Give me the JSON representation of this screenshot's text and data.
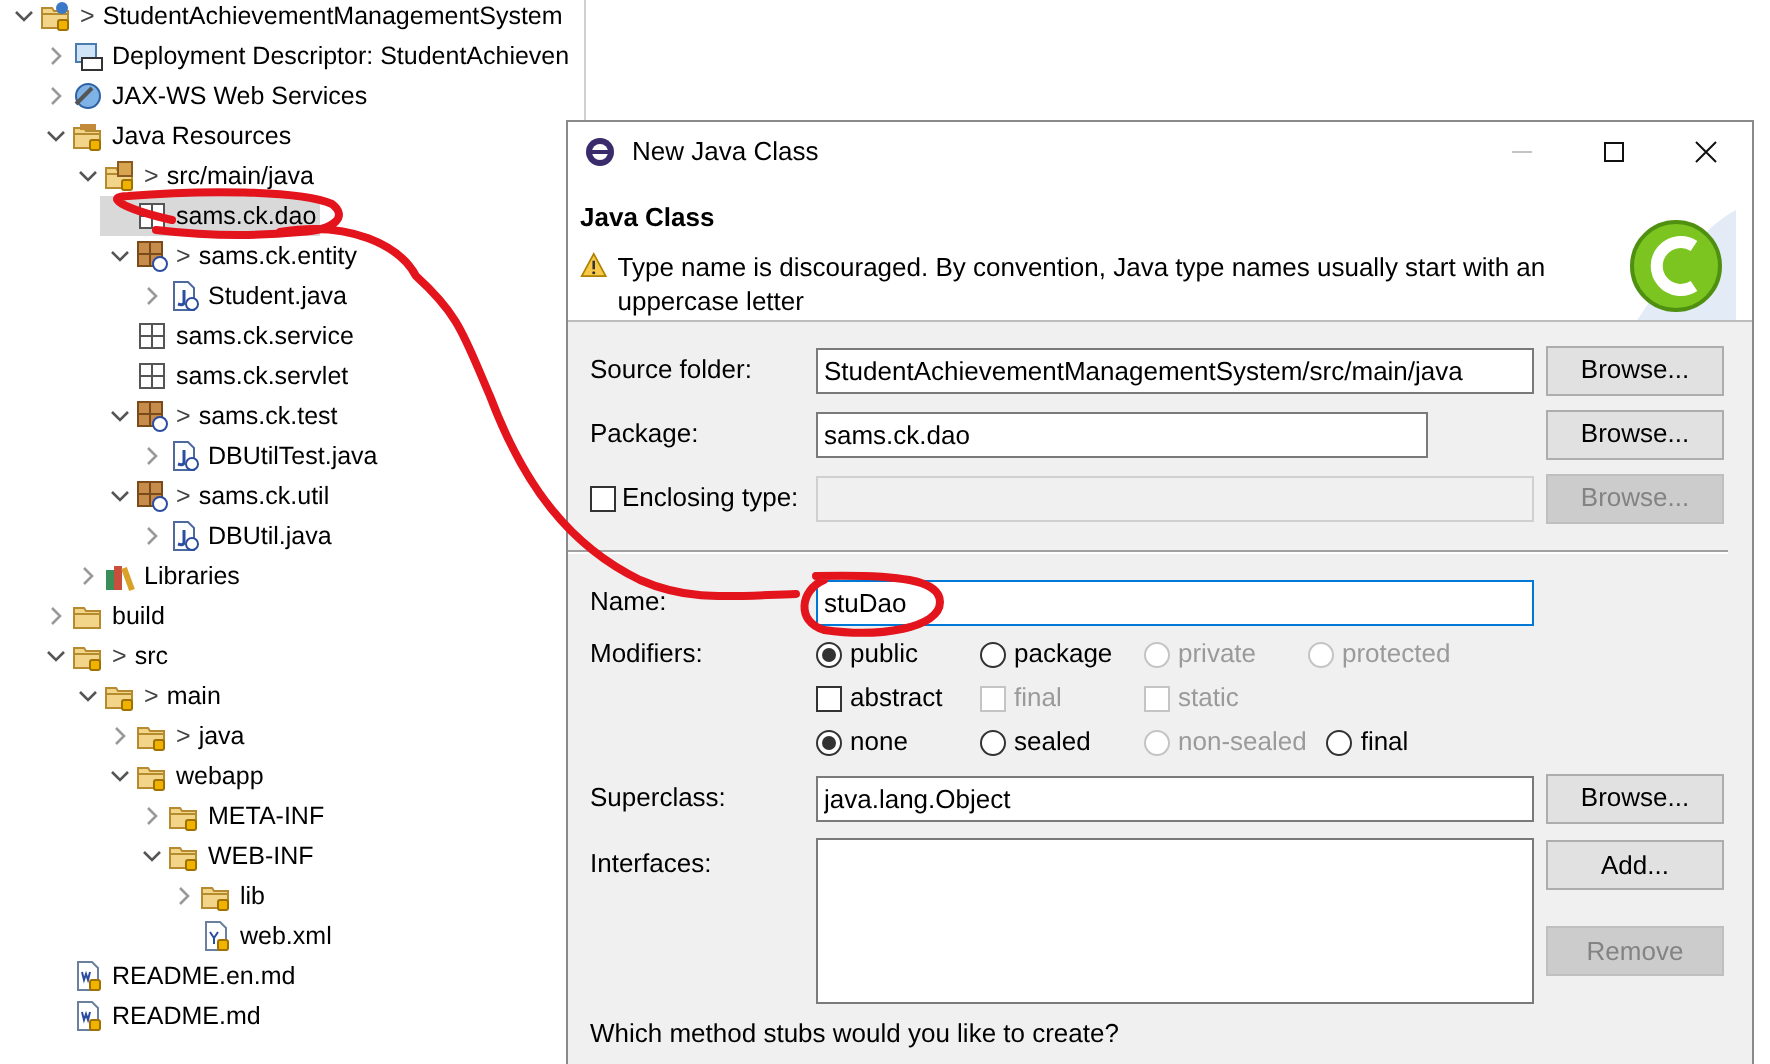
{
  "tree": [
    {
      "label": "StudentAchievementManagementSystem",
      "kind": "project",
      "mark": ">",
      "expanded": true,
      "selected": false,
      "children": [
        {
          "label": "Deployment Descriptor: StudentAchieven",
          "kind": "descriptor",
          "expanded": false,
          "selected": false
        },
        {
          "label": "JAX-WS Web Services",
          "kind": "webservices",
          "expanded": false,
          "selected": false
        },
        {
          "label": "Java Resources",
          "kind": "java-resources",
          "expanded": true,
          "selected": false,
          "children": [
            {
              "label": "src/main/java",
              "kind": "source-folder",
              "mark": ">",
              "expanded": true,
              "selected": false,
              "children": [
                {
                  "label": "sams.ck.dao",
                  "kind": "package",
                  "selected": true
                },
                {
                  "label": "sams.ck.entity",
                  "kind": "package-changed",
                  "mark": ">",
                  "expanded": true,
                  "selected": false,
                  "children": [
                    {
                      "label": "Student.java",
                      "kind": "java-file",
                      "expanded": false,
                      "selected": false
                    }
                  ]
                },
                {
                  "label": "sams.ck.service",
                  "kind": "package",
                  "selected": false
                },
                {
                  "label": "sams.ck.servlet",
                  "kind": "package",
                  "selected": false
                },
                {
                  "label": "sams.ck.test",
                  "kind": "package-changed",
                  "mark": ">",
                  "expanded": true,
                  "selected": false,
                  "children": [
                    {
                      "label": "DBUtilTest.java",
                      "kind": "java-file",
                      "expanded": false,
                      "selected": false
                    }
                  ]
                },
                {
                  "label": "sams.ck.util",
                  "kind": "package-changed",
                  "mark": ">",
                  "expanded": true,
                  "selected": false,
                  "children": [
                    {
                      "label": "DBUtil.java",
                      "kind": "java-file",
                      "expanded": false,
                      "selected": false
                    }
                  ]
                }
              ]
            },
            {
              "label": "Libraries",
              "kind": "libraries",
              "expanded": false,
              "selected": false
            }
          ]
        },
        {
          "label": "build",
          "kind": "folder",
          "expanded": false,
          "selected": false
        },
        {
          "label": "src",
          "kind": "folder-tracked",
          "mark": ">",
          "expanded": true,
          "selected": false,
          "children": [
            {
              "label": "main",
              "kind": "folder-tracked",
              "mark": ">",
              "expanded": true,
              "selected": false,
              "children": [
                {
                  "label": "java",
                  "kind": "folder-tracked",
                  "mark": ">",
                  "expanded": false,
                  "selected": false
                },
                {
                  "label": "webapp",
                  "kind": "folder-tracked",
                  "expanded": true,
                  "selected": false,
                  "children": [
                    {
                      "label": "META-INF",
                      "kind": "folder-tracked",
                      "expanded": false,
                      "selected": false
                    },
                    {
                      "label": "WEB-INF",
                      "kind": "folder-tracked",
                      "expanded": true,
                      "selected": false,
                      "children": [
                        {
                          "label": "lib",
                          "kind": "folder-tracked",
                          "expanded": false,
                          "selected": false
                        },
                        {
                          "label": "web.xml",
                          "kind": "xml-file",
                          "selected": false
                        }
                      ]
                    }
                  ]
                }
              ]
            }
          ]
        },
        {
          "label": "README.en.md",
          "kind": "text-file",
          "selected": false
        },
        {
          "label": "README.md",
          "kind": "text-file",
          "selected": false
        }
      ]
    }
  ],
  "dialog": {
    "title": "New Java Class",
    "title_buttons": [
      {
        "kind": "minimize",
        "disabled": true
      },
      {
        "kind": "maximize",
        "disabled": false
      },
      {
        "kind": "close",
        "disabled": false
      }
    ],
    "heading": "Java Class",
    "message": "Type name is discouraged. By convention, Java type names usually start with an uppercase letter",
    "rows": [
      {
        "kind": "text",
        "label": "Source folder:",
        "value": "StudentAchievementManagementSystem/src/main/java",
        "focused": false,
        "button": {
          "label": "Browse...",
          "disabled": false
        }
      },
      {
        "kind": "short-text",
        "label": "Package:",
        "value": "sams.ck.dao",
        "focused": false,
        "button": {
          "label": "Browse...",
          "disabled": false
        }
      },
      {
        "kind": "check-text",
        "label": "Enclosing type:",
        "checked": false,
        "disabled": true,
        "button": {
          "label": "Browse...",
          "disabled": true
        }
      },
      {
        "kind": "separator"
      },
      {
        "kind": "text",
        "label": "Name:",
        "value": "stuDao",
        "focused": true
      },
      {
        "kind": "options",
        "label": "Modifiers:",
        "groups": [
          [
            {
              "kind": "radio",
              "label": "public",
              "selected": true,
              "disabled": false
            },
            {
              "kind": "radio",
              "label": "package",
              "selected": false,
              "disabled": false
            },
            {
              "kind": "radio",
              "label": "private",
              "selected": false,
              "disabled": true
            },
            {
              "kind": "radio",
              "label": "protected",
              "selected": false,
              "disabled": true
            }
          ],
          [
            {
              "kind": "checkbox",
              "label": "abstract",
              "checked": false,
              "disabled": false
            },
            {
              "kind": "checkbox",
              "label": "final",
              "checked": false,
              "disabled": true
            },
            {
              "kind": "checkbox",
              "label": "static",
              "checked": false,
              "disabled": true
            }
          ],
          [
            {
              "kind": "radio",
              "label": "none",
              "selected": true,
              "disabled": false
            },
            {
              "kind": "radio",
              "label": "sealed",
              "selected": false,
              "disabled": false
            },
            {
              "kind": "radio",
              "label": "non-sealed",
              "selected": false,
              "disabled": true
            },
            {
              "kind": "radio",
              "label": "final",
              "selected": false,
              "disabled": false
            }
          ]
        ]
      },
      {
        "kind": "text",
        "label": "Superclass:",
        "value": "java.lang.Object",
        "focused": false,
        "button": {
          "label": "Browse...",
          "disabled": false
        }
      },
      {
        "kind": "list",
        "label": "Interfaces:",
        "buttons": [
          {
            "label": "Add...",
            "disabled": false
          },
          {
            "label": "Remove",
            "disabled": true
          }
        ]
      },
      {
        "kind": "note",
        "label": "Which method stubs would you like to create?"
      }
    ]
  }
}
